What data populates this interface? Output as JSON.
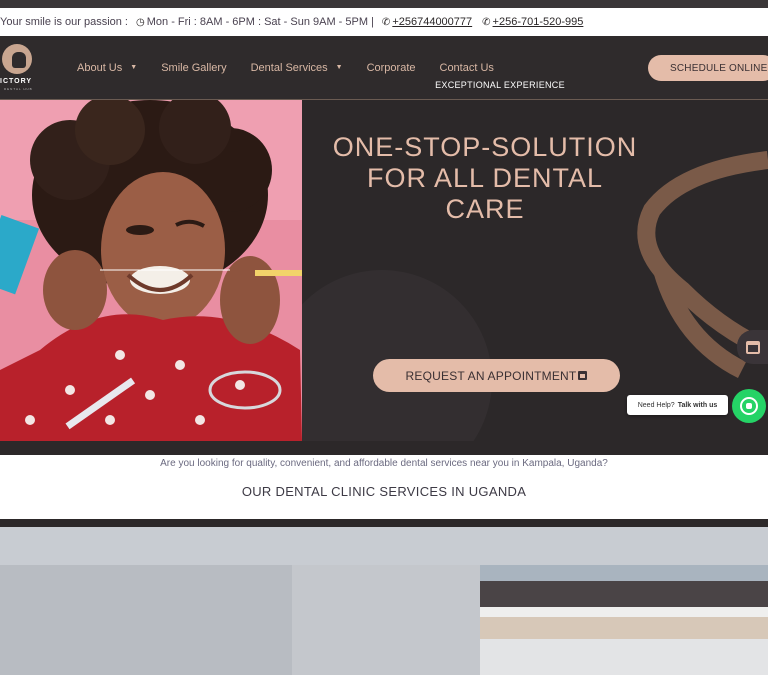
{
  "infobar": {
    "passion": "Your smile is our passion :",
    "hours": "Mon - Fri : 8AM - 6PM : Sat - Sun 9AM - 5PM |",
    "phone1": "+256744000777",
    "phone2": "+256-701-520-995"
  },
  "logo": {
    "word": "ICTORY",
    "sub": "DENTAL HUB"
  },
  "nav": {
    "items": [
      {
        "label": "About Us",
        "dropdown": true
      },
      {
        "label": "Smile Gallery",
        "dropdown": false
      },
      {
        "label": "Dental Services",
        "dropdown": true
      },
      {
        "label": "Corporate",
        "dropdown": false
      },
      {
        "label": "Contact Us",
        "dropdown": false
      }
    ],
    "cta": "SCHEDULE ONLINE"
  },
  "hero": {
    "kicker": "EXCEPTIONAL EXPERIENCE",
    "headline": "ONE-STOP-SOLUTION FOR ALL DENTAL CARE",
    "button": "REQUEST AN APPOINTMENT"
  },
  "help": {
    "need": "Need Help?",
    "talk": "Talk with us"
  },
  "intro": {
    "question": "Are you looking for quality, convenient, and affordable dental services near you in Kampala, Uganda?",
    "heading": "OUR DENTAL CLINIC SERVICES IN UGANDA"
  },
  "colors": {
    "accent": "#e4bca9",
    "dark": "#2c2829",
    "whatsapp": "#25d366"
  },
  "icons": [
    "clock-icon",
    "phone-icon",
    "chevron-down-icon",
    "calendar-icon",
    "whatsapp-icon"
  ]
}
